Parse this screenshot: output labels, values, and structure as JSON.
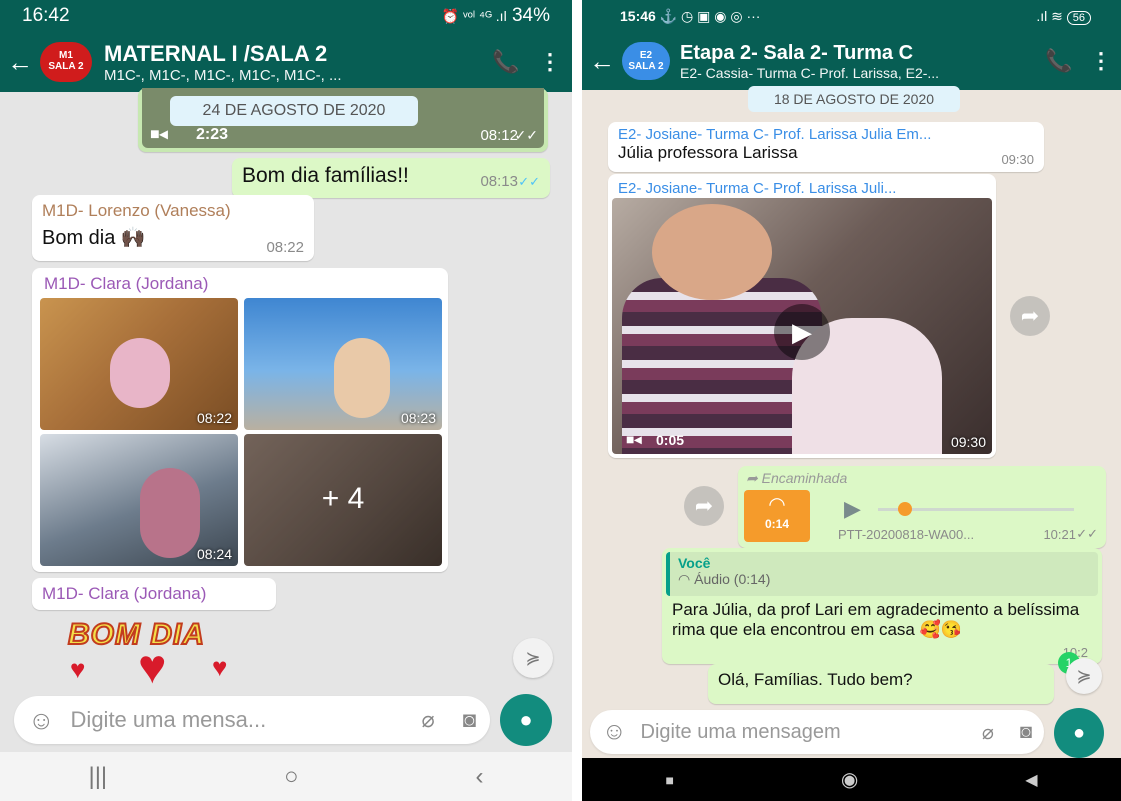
{
  "left": {
    "status": {
      "time": "16:42",
      "icons": "⏰ ᵛᵒˡ ⁴ᴳ .ıl",
      "battery": "34%"
    },
    "header": {
      "avatar_text1": "M1",
      "avatar_text2": "SALA 2",
      "title": "MATERNAL I /SALA 2",
      "subtitle": "M1C-, M1C-, M1C-, M1C-, M1C-, ..."
    },
    "video": {
      "date": "24 DE AGOSTO DE 2020",
      "duration": "2:23",
      "time": "08:12"
    },
    "messages": [
      {
        "text": "Bom dia famílias!!",
        "time": "08:13"
      },
      {
        "sender": "M1D- Lorenzo (Vanessa)",
        "text": "Bom dia 🙌🏿",
        "time": "08:22"
      },
      {
        "sender": "M1D- Clara (Jordana)"
      },
      {
        "sender": "M1D- Clara (Jordana)"
      }
    ],
    "photos": [
      "08:22",
      "08:23",
      "08:24",
      "+ 4"
    ],
    "sticker": {
      "text": "BOM DIA"
    },
    "input": {
      "placeholder": "Digite uma mensa..."
    },
    "navbar": [
      "|||",
      "○",
      "‹"
    ],
    "colors": {
      "header": "#075e54",
      "bubble_out": "#dcf8c6",
      "sender_left_1": "#b07f5a",
      "sender_left_2": "#9b59b6"
    }
  },
  "right": {
    "status": {
      "time": "15:46",
      "icons": "⚓ ◷ ▣ ◉ ◎ ···",
      "signal": ".ıl ≋",
      "battery": "56"
    },
    "header": {
      "avatar_text1": "E2",
      "avatar_text2": "SALA 2",
      "title": "Etapa 2- Sala 2- Turma C",
      "subtitle": "E2- Cassia- Turma C- Prof. Larissa, E2-..."
    },
    "date": "18 DE AGOSTO DE 2020",
    "msg1": {
      "sender": "E2- Josiane- Turma C- Prof. Larissa Julia Em...",
      "text": "Júlia professora Larissa",
      "time": "09:30"
    },
    "msg2": {
      "sender": "E2- Josiane- Turma C- Prof. Larissa Juli...",
      "duration": "0:05",
      "time": "09:30"
    },
    "audio": {
      "forwarded": "Encaminhada",
      "duration": "0:14",
      "file": "PTT-20200818-WA00...",
      "time": "10:21"
    },
    "reply": {
      "quote_sender": "Você",
      "quote_text": "Áudio (0:14)",
      "text": "Para Júlia, da prof Lari em agradecimento a belíssima rima que ela encontrou em casa 🥰😘",
      "time": "10:2"
    },
    "last": {
      "text": "Olá, Famílias. Tudo bem?",
      "badge": "1"
    },
    "input": {
      "placeholder": "Digite uma mensagem"
    }
  }
}
